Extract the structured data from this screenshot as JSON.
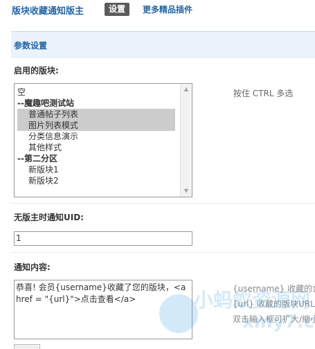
{
  "header": {
    "title": "版块收藏通知版主",
    "settings_tab": "设置",
    "more_link": "更多精品插件"
  },
  "section": {
    "title": "参数设置"
  },
  "forums_field": {
    "label": "启用的版块:",
    "hint": "按住 CTRL 多选",
    "options": [
      {
        "label": "空",
        "selected": false,
        "kind": "plain"
      },
      {
        "label": "--魔趣吧测试站",
        "selected": false,
        "kind": "group"
      },
      {
        "label": "普通帖子列表",
        "selected": true,
        "kind": "indent"
      },
      {
        "label": "图片列表模式",
        "selected": true,
        "kind": "indent"
      },
      {
        "label": "分类信息演示",
        "selected": false,
        "kind": "indent"
      },
      {
        "label": "其他样式",
        "selected": false,
        "kind": "indent"
      },
      {
        "label": "--第二分区",
        "selected": false,
        "kind": "group"
      },
      {
        "label": "新版块1",
        "selected": false,
        "kind": "indent"
      },
      {
        "label": "新版块2",
        "selected": false,
        "kind": "indent"
      }
    ]
  },
  "uid_field": {
    "label": "无版主时通知UID:",
    "value": "1"
  },
  "content_field": {
    "label": "通知内容:",
    "value": "恭喜! 会员{username}收藏了您的版块，<a href = \"{url}\">点击查看</a>",
    "hints": [
      "{username} 收藏的会",
      "{url} 收藏的版块URL",
      "双击输入框可扩大/缩小"
    ]
  },
  "watermark": {
    "text": "小蚂蚁资源网",
    "url": "xmy7.com"
  },
  "colors": {
    "link": "#2366a8",
    "tab_bg": "#5b5b5b",
    "section_bg": "#eaf2fb",
    "selected_bg": "#cccccc"
  }
}
